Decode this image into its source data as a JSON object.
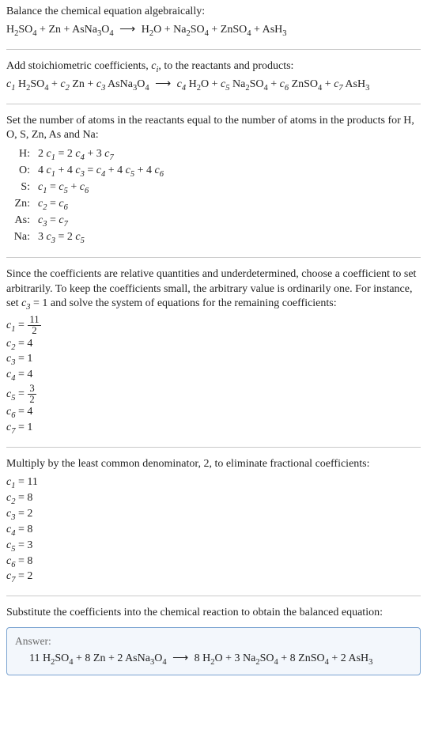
{
  "intro": "Balance the chemical equation algebraically:",
  "reaction_plain": {
    "reactants": [
      "H2SO4",
      "Zn",
      "AsNa3O4"
    ],
    "products": [
      "H2O",
      "Na2SO4",
      "ZnSO4",
      "AsH3"
    ]
  },
  "stoich_text": "Add stoichiometric coefficients, c_i, to the reactants and products:",
  "stoich_prefix": "Add stoichiometric coefficients, ",
  "stoich_ci": "c",
  "stoich_suffix": ", to the reactants and products:",
  "reaction_coeff": {
    "terms_left": [
      {
        "c": "c1",
        "sp": "H2SO4"
      },
      {
        "c": "c2",
        "sp": "Zn"
      },
      {
        "c": "c3",
        "sp": "AsNa3O4"
      }
    ],
    "terms_right": [
      {
        "c": "c4",
        "sp": "H2O"
      },
      {
        "c": "c5",
        "sp": "Na2SO4"
      },
      {
        "c": "c6",
        "sp": "ZnSO4"
      },
      {
        "c": "c7",
        "sp": "AsH3"
      }
    ]
  },
  "atoms_intro": "Set the number of atoms in the reactants equal to the number of atoms in the products for H, O, S, Zn, As and Na:",
  "atoms": [
    {
      "el": "H:",
      "lhs": "2 c1",
      "rhs": "2 c4 + 3 c7"
    },
    {
      "el": "O:",
      "lhs": "4 c1 + 4 c3",
      "rhs": "c4 + 4 c5 + 4 c6"
    },
    {
      "el": "S:",
      "lhs": "c1",
      "rhs": "c5 + c6"
    },
    {
      "el": "Zn:",
      "lhs": "c2",
      "rhs": "c6"
    },
    {
      "el": "As:",
      "lhs": "c3",
      "rhs": "c7"
    },
    {
      "el": "Na:",
      "lhs": "3 c3",
      "rhs": "2 c5"
    }
  ],
  "underdet": "Since the coefficients are relative quantities and underdetermined, choose a coefficient to set arbitrarily. To keep the coefficients small, the arbitrary value is ordinarily one. For instance, set c3 = 1 and solve the system of equations for the remaining coefficients:",
  "underdet_prefix": "Since the coefficients are relative quantities and underdetermined, choose a coefficient to set arbitrarily. To keep the coefficients small, the arbitrary value is ordinarily one. For instance, set ",
  "underdet_c3": "c",
  "underdet_c3sub": "3",
  "underdet_mid": " = 1 and solve the system of equations for the remaining coefficients:",
  "solve1": [
    {
      "c": "c1",
      "val": "11/2",
      "frac": true
    },
    {
      "c": "c2",
      "val": "4"
    },
    {
      "c": "c3",
      "val": "1"
    },
    {
      "c": "c4",
      "val": "4"
    },
    {
      "c": "c5",
      "val": "3/2",
      "frac": true
    },
    {
      "c": "c6",
      "val": "4"
    },
    {
      "c": "c7",
      "val": "1"
    }
  ],
  "lcd": "Multiply by the least common denominator, 2, to eliminate fractional coefficients:",
  "solve2": [
    {
      "c": "c1",
      "val": "11"
    },
    {
      "c": "c2",
      "val": "8"
    },
    {
      "c": "c3",
      "val": "2"
    },
    {
      "c": "c4",
      "val": "8"
    },
    {
      "c": "c5",
      "val": "3"
    },
    {
      "c": "c6",
      "val": "8"
    },
    {
      "c": "c7",
      "val": "2"
    }
  ],
  "final_intro": "Substitute the coefficients into the chemical reaction to obtain the balanced equation:",
  "answer_label": "Answer:",
  "balanced": {
    "left": [
      {
        "n": "11",
        "sp": "H2SO4"
      },
      {
        "n": "8",
        "sp": "Zn"
      },
      {
        "n": "2",
        "sp": "AsNa3O4"
      }
    ],
    "right": [
      {
        "n": "8",
        "sp": "H2O"
      },
      {
        "n": "3",
        "sp": "Na2SO4"
      },
      {
        "n": "8",
        "sp": "ZnSO4"
      },
      {
        "n": "2",
        "sp": "AsH3"
      }
    ]
  },
  "plus": " + ",
  "eq": " = ",
  "arrow": "⟶"
}
